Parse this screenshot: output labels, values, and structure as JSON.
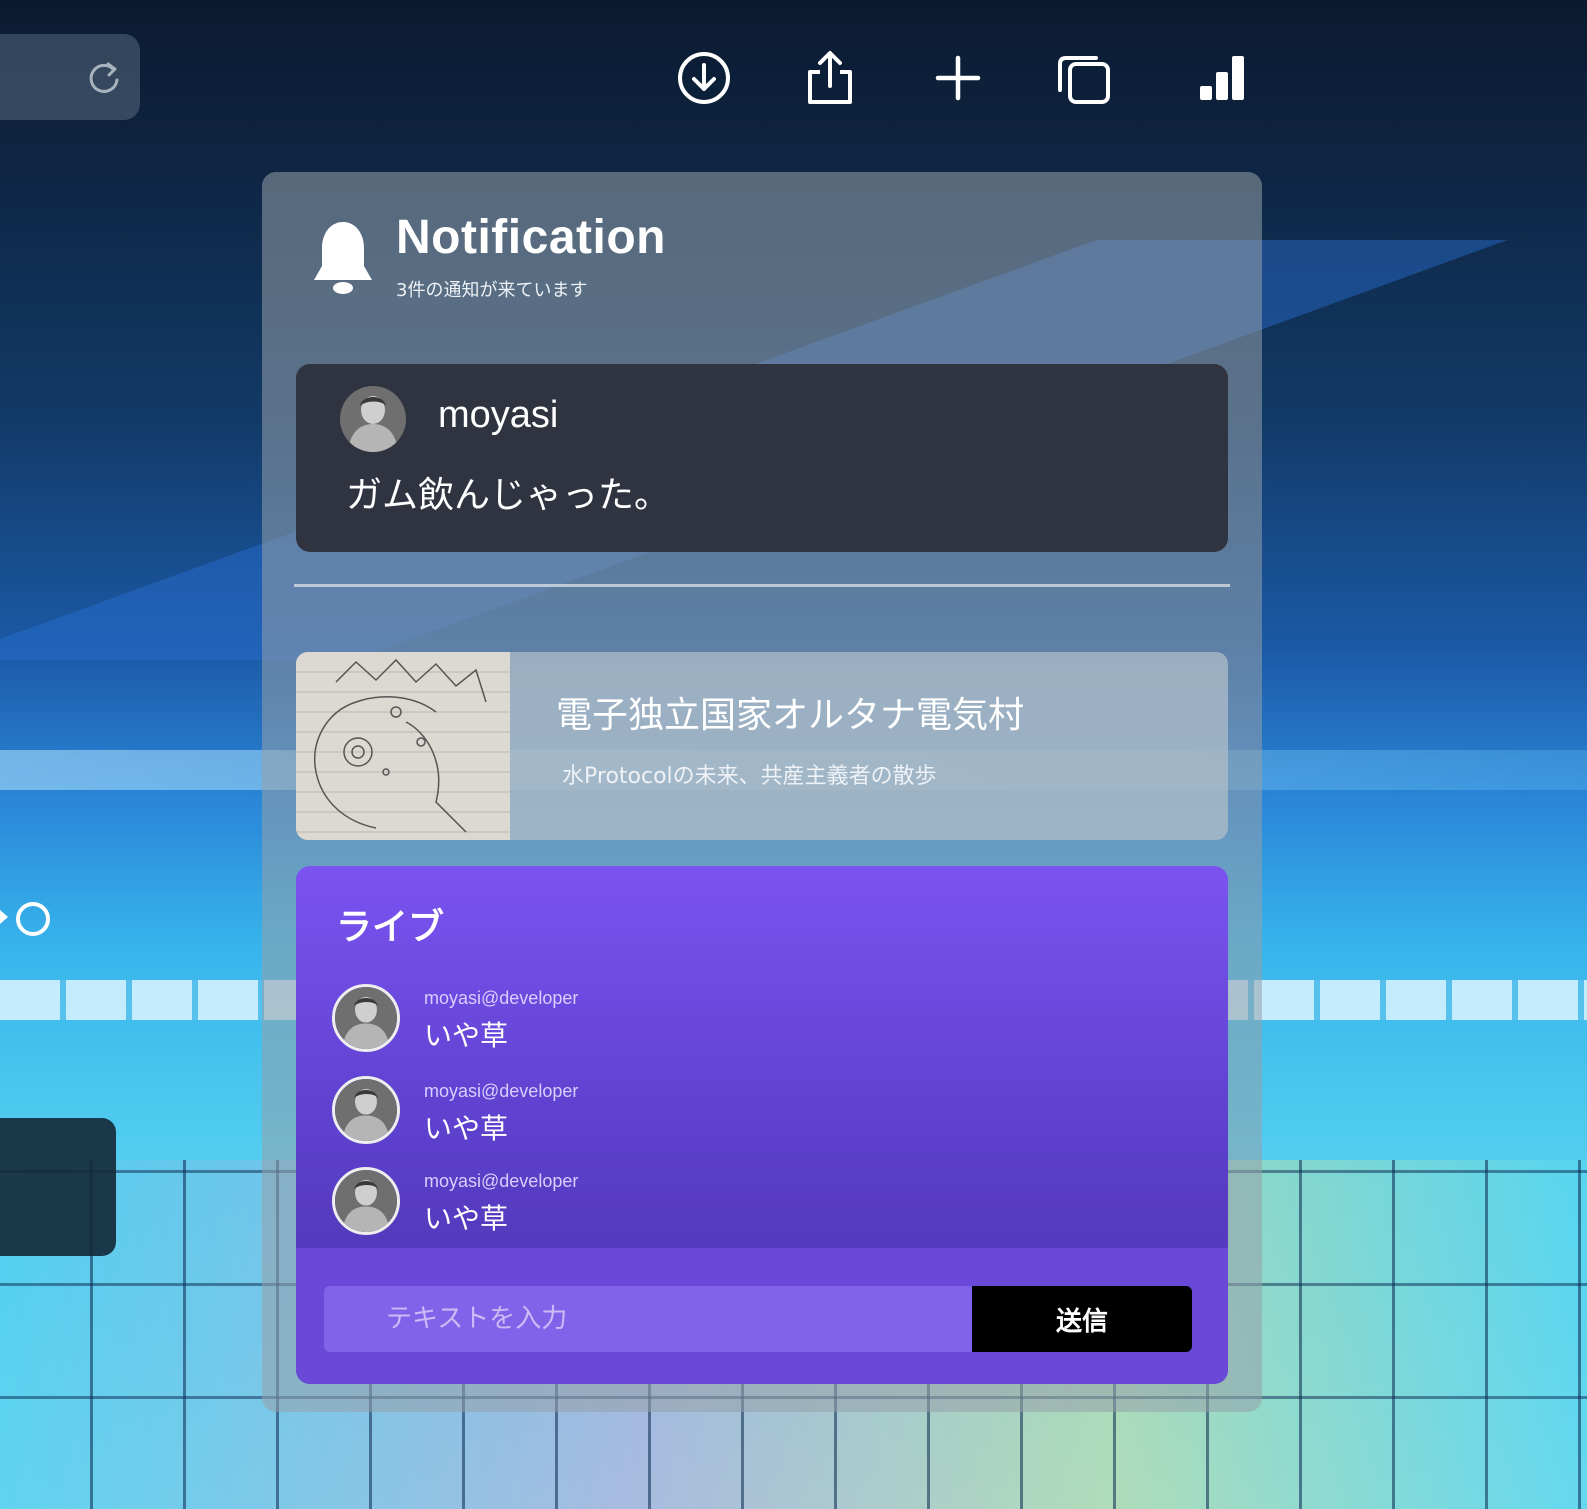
{
  "toolbar": {
    "icons": [
      "download-icon",
      "share-icon",
      "plus-icon",
      "duplicate-icon",
      "signal-icon"
    ]
  },
  "notification": {
    "title": "Notification",
    "subtitle": "3件の通知が来ています",
    "message": {
      "user": "moyasi",
      "text": "ガム飲んじゃった。"
    },
    "article": {
      "title": "電子独立国家オルタナ電気村",
      "subtitle": "水Protocolの未来、共産主義者の散歩"
    }
  },
  "live": {
    "title": "ライブ",
    "items": [
      {
        "user": "moyasi@developer",
        "text": "いや草"
      },
      {
        "user": "moyasi@developer",
        "text": "いや草"
      },
      {
        "user": "moyasi@developer",
        "text": "いや草"
      }
    ],
    "input_placeholder": "テキストを入力",
    "send_label": "送信"
  },
  "colors": {
    "live_top": "#7b53f1",
    "live_bottom": "#4a33a8",
    "message_card": "#2f3440",
    "send_button": "#000000"
  }
}
